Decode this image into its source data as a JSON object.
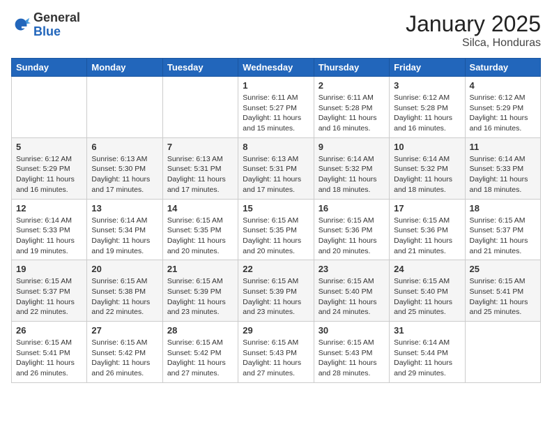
{
  "logo": {
    "general": "General",
    "blue": "Blue"
  },
  "header": {
    "month": "January 2025",
    "location": "Silca, Honduras"
  },
  "weekdays": [
    "Sunday",
    "Monday",
    "Tuesday",
    "Wednesday",
    "Thursday",
    "Friday",
    "Saturday"
  ],
  "weeks": [
    [
      {
        "day": "",
        "info": ""
      },
      {
        "day": "",
        "info": ""
      },
      {
        "day": "",
        "info": ""
      },
      {
        "day": "1",
        "sunrise": "Sunrise: 6:11 AM",
        "sunset": "Sunset: 5:27 PM",
        "daylight": "Daylight: 11 hours and 15 minutes."
      },
      {
        "day": "2",
        "sunrise": "Sunrise: 6:11 AM",
        "sunset": "Sunset: 5:28 PM",
        "daylight": "Daylight: 11 hours and 16 minutes."
      },
      {
        "day": "3",
        "sunrise": "Sunrise: 6:12 AM",
        "sunset": "Sunset: 5:28 PM",
        "daylight": "Daylight: 11 hours and 16 minutes."
      },
      {
        "day": "4",
        "sunrise": "Sunrise: 6:12 AM",
        "sunset": "Sunset: 5:29 PM",
        "daylight": "Daylight: 11 hours and 16 minutes."
      }
    ],
    [
      {
        "day": "5",
        "sunrise": "Sunrise: 6:12 AM",
        "sunset": "Sunset: 5:29 PM",
        "daylight": "Daylight: 11 hours and 16 minutes."
      },
      {
        "day": "6",
        "sunrise": "Sunrise: 6:13 AM",
        "sunset": "Sunset: 5:30 PM",
        "daylight": "Daylight: 11 hours and 17 minutes."
      },
      {
        "day": "7",
        "sunrise": "Sunrise: 6:13 AM",
        "sunset": "Sunset: 5:31 PM",
        "daylight": "Daylight: 11 hours and 17 minutes."
      },
      {
        "day": "8",
        "sunrise": "Sunrise: 6:13 AM",
        "sunset": "Sunset: 5:31 PM",
        "daylight": "Daylight: 11 hours and 17 minutes."
      },
      {
        "day": "9",
        "sunrise": "Sunrise: 6:14 AM",
        "sunset": "Sunset: 5:32 PM",
        "daylight": "Daylight: 11 hours and 18 minutes."
      },
      {
        "day": "10",
        "sunrise": "Sunrise: 6:14 AM",
        "sunset": "Sunset: 5:32 PM",
        "daylight": "Daylight: 11 hours and 18 minutes."
      },
      {
        "day": "11",
        "sunrise": "Sunrise: 6:14 AM",
        "sunset": "Sunset: 5:33 PM",
        "daylight": "Daylight: 11 hours and 18 minutes."
      }
    ],
    [
      {
        "day": "12",
        "sunrise": "Sunrise: 6:14 AM",
        "sunset": "Sunset: 5:33 PM",
        "daylight": "Daylight: 11 hours and 19 minutes."
      },
      {
        "day": "13",
        "sunrise": "Sunrise: 6:14 AM",
        "sunset": "Sunset: 5:34 PM",
        "daylight": "Daylight: 11 hours and 19 minutes."
      },
      {
        "day": "14",
        "sunrise": "Sunrise: 6:15 AM",
        "sunset": "Sunset: 5:35 PM",
        "daylight": "Daylight: 11 hours and 20 minutes."
      },
      {
        "day": "15",
        "sunrise": "Sunrise: 6:15 AM",
        "sunset": "Sunset: 5:35 PM",
        "daylight": "Daylight: 11 hours and 20 minutes."
      },
      {
        "day": "16",
        "sunrise": "Sunrise: 6:15 AM",
        "sunset": "Sunset: 5:36 PM",
        "daylight": "Daylight: 11 hours and 20 minutes."
      },
      {
        "day": "17",
        "sunrise": "Sunrise: 6:15 AM",
        "sunset": "Sunset: 5:36 PM",
        "daylight": "Daylight: 11 hours and 21 minutes."
      },
      {
        "day": "18",
        "sunrise": "Sunrise: 6:15 AM",
        "sunset": "Sunset: 5:37 PM",
        "daylight": "Daylight: 11 hours and 21 minutes."
      }
    ],
    [
      {
        "day": "19",
        "sunrise": "Sunrise: 6:15 AM",
        "sunset": "Sunset: 5:37 PM",
        "daylight": "Daylight: 11 hours and 22 minutes."
      },
      {
        "day": "20",
        "sunrise": "Sunrise: 6:15 AM",
        "sunset": "Sunset: 5:38 PM",
        "daylight": "Daylight: 11 hours and 22 minutes."
      },
      {
        "day": "21",
        "sunrise": "Sunrise: 6:15 AM",
        "sunset": "Sunset: 5:39 PM",
        "daylight": "Daylight: 11 hours and 23 minutes."
      },
      {
        "day": "22",
        "sunrise": "Sunrise: 6:15 AM",
        "sunset": "Sunset: 5:39 PM",
        "daylight": "Daylight: 11 hours and 23 minutes."
      },
      {
        "day": "23",
        "sunrise": "Sunrise: 6:15 AM",
        "sunset": "Sunset: 5:40 PM",
        "daylight": "Daylight: 11 hours and 24 minutes."
      },
      {
        "day": "24",
        "sunrise": "Sunrise: 6:15 AM",
        "sunset": "Sunset: 5:40 PM",
        "daylight": "Daylight: 11 hours and 25 minutes."
      },
      {
        "day": "25",
        "sunrise": "Sunrise: 6:15 AM",
        "sunset": "Sunset: 5:41 PM",
        "daylight": "Daylight: 11 hours and 25 minutes."
      }
    ],
    [
      {
        "day": "26",
        "sunrise": "Sunrise: 6:15 AM",
        "sunset": "Sunset: 5:41 PM",
        "daylight": "Daylight: 11 hours and 26 minutes."
      },
      {
        "day": "27",
        "sunrise": "Sunrise: 6:15 AM",
        "sunset": "Sunset: 5:42 PM",
        "daylight": "Daylight: 11 hours and 26 minutes."
      },
      {
        "day": "28",
        "sunrise": "Sunrise: 6:15 AM",
        "sunset": "Sunset: 5:42 PM",
        "daylight": "Daylight: 11 hours and 27 minutes."
      },
      {
        "day": "29",
        "sunrise": "Sunrise: 6:15 AM",
        "sunset": "Sunset: 5:43 PM",
        "daylight": "Daylight: 11 hours and 27 minutes."
      },
      {
        "day": "30",
        "sunrise": "Sunrise: 6:15 AM",
        "sunset": "Sunset: 5:43 PM",
        "daylight": "Daylight: 11 hours and 28 minutes."
      },
      {
        "day": "31",
        "sunrise": "Sunrise: 6:14 AM",
        "sunset": "Sunset: 5:44 PM",
        "daylight": "Daylight: 11 hours and 29 minutes."
      },
      {
        "day": "",
        "info": ""
      }
    ]
  ]
}
